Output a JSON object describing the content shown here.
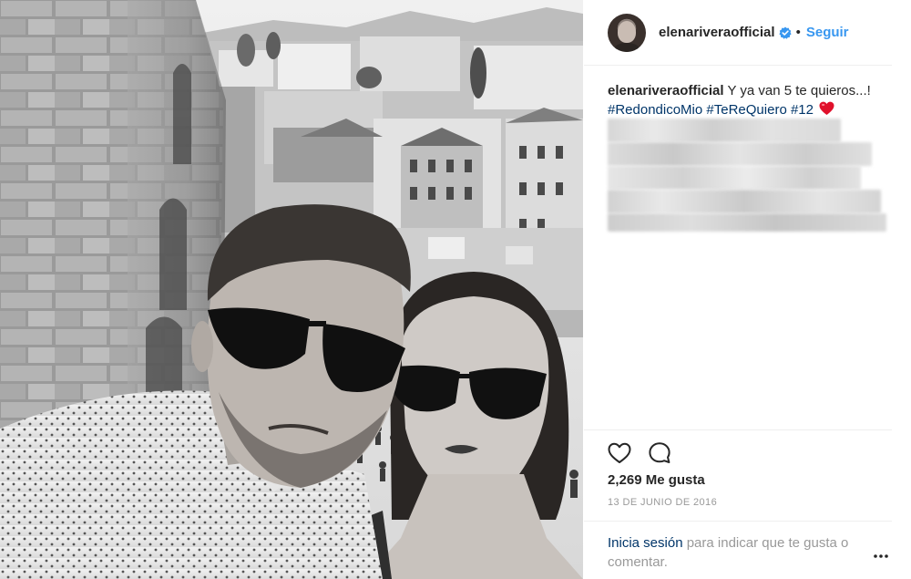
{
  "post": {
    "username": "elenariveraofficial",
    "verified_icon": "verified-badge-icon",
    "separator": "•",
    "follow_label": "Seguir",
    "caption": {
      "username": "elenariveraofficial",
      "text": "Y ya van 5 te quieros...!",
      "hashtags": [
        "#RedondicoMio",
        "#TeReQuiero",
        "#12"
      ],
      "emoji": "red-heart-icon"
    },
    "likes_count": "2,269",
    "likes_label": "Me gusta",
    "date": "13 DE JUNIO DE 2016",
    "footer": {
      "login_link": "Inicia sesión",
      "login_text": "para indicar que te gusta o comentar."
    },
    "icons": {
      "like": "heart-outline-icon",
      "comment": "comment-bubble-icon",
      "more": "more-options-icon"
    },
    "colors": {
      "link": "#3897f0",
      "hashtag": "#003569",
      "muted": "#999999",
      "text": "#262626"
    }
  }
}
